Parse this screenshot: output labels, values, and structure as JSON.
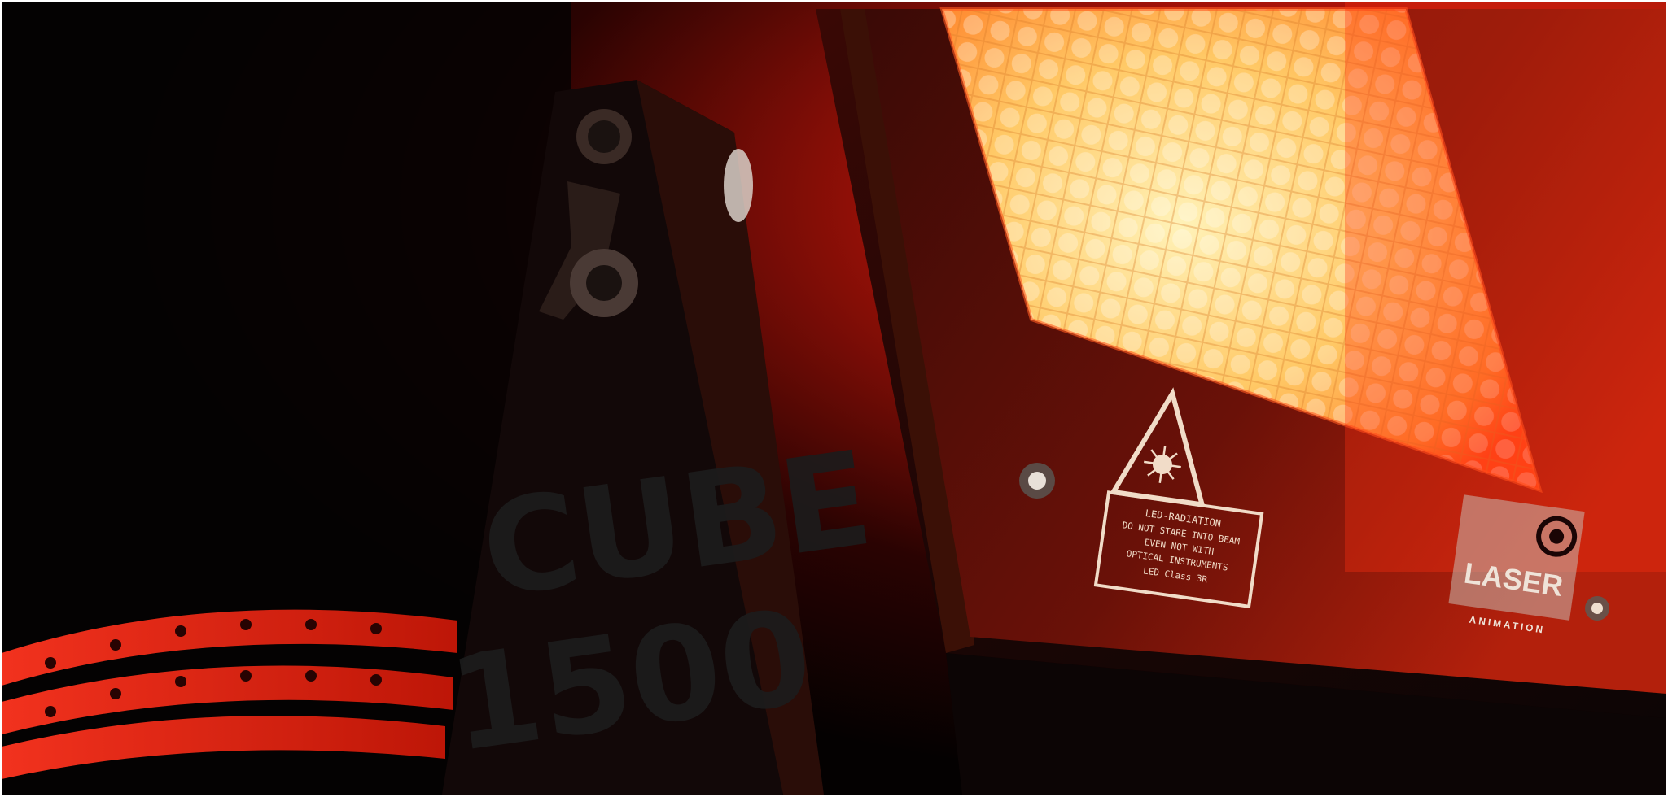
{
  "photo": {
    "subject": "LED laser-style light fixture",
    "warning_label": {
      "lines": [
        "LED-RADIATION",
        "DO NOT STARE INTO BEAM",
        "EVEN NOT WITH",
        "OPTICAL INSTRUMENTS",
        "LED Class 3R"
      ]
    },
    "brand": {
      "name": "LASER",
      "sub": "ANIMATION"
    },
    "stencil_text": [
      "CUBE",
      "1500"
    ],
    "colors": {
      "glow": "#ff2a10",
      "panel": "#ffd27a",
      "body": "#141414"
    }
  }
}
